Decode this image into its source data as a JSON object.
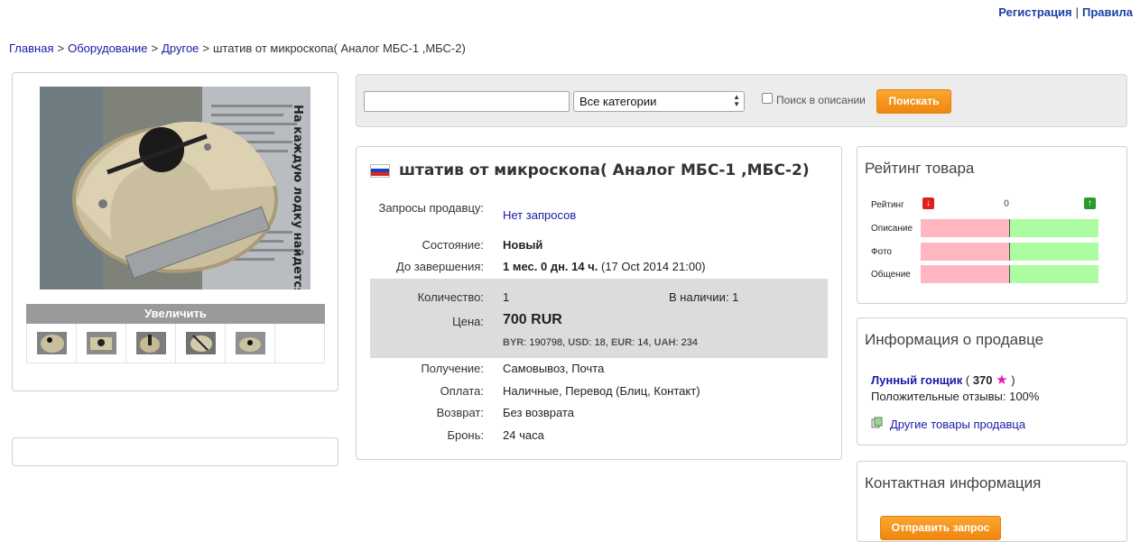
{
  "topbar": {
    "register": "Регистрация",
    "separator": "|",
    "rules": "Правила"
  },
  "breadcrumb": {
    "items": [
      "Главная",
      "Оборудование",
      "Другое"
    ],
    "current": "штатив от микроскопа( Аналог МБС-1 ,МБС-2)",
    "separator": ">"
  },
  "gallery": {
    "enlarge": "Увеличить",
    "thumb_count": 5,
    "main_photo_text": "На каждую лодку найдется своя «Булава»"
  },
  "search": {
    "query": "",
    "category": "Все категории",
    "in_description": "Поиск в описании",
    "in_description_checked": false,
    "button": "Поискать"
  },
  "product": {
    "title": "штатив от микроскопа( Аналог МБС-1 ,МБС-2)",
    "country_flag": "russia-flag",
    "requests_label": "Запросы продавцу:",
    "requests_value": "Нет запросов",
    "condition_label": "Состояние:",
    "condition_value": "Новый",
    "ends_label": "До завершения:",
    "ends_value": "1 мес. 0 дн. 14 ч.",
    "ends_date": "(17 Oct 2014 21:00)",
    "quantity_label": "Количество:",
    "quantity_value": "1",
    "in_stock_label": "В наличии:",
    "in_stock_value": "1",
    "price_label": "Цена:",
    "price_value": "700 RUR",
    "currencies": {
      "byr_label": "BYR",
      "byr_value": "190798",
      "usd_label": "USD",
      "usd_value": "18",
      "eur_label": "EUR",
      "eur_value": "14",
      "uah_label": "UAH",
      "uah_value": "234"
    },
    "delivery_label": "Получение:",
    "delivery_value": "Самовывоз, Почта",
    "payment_label": "Оплата:",
    "payment_value": "Наличные, Перевод (Блиц, Контакт)",
    "return_label": "Возврат:",
    "return_value": "Без возврата",
    "reserve_label": "Бронь:",
    "reserve_value": "24 часа"
  },
  "rating": {
    "heading": "Рейтинг товара",
    "rating_label": "Рейтинг",
    "rating_value": "0",
    "rows": [
      "Описание",
      "Фото",
      "Общение"
    ],
    "negative_share": 0.5,
    "colors": {
      "negative": "#ffb6c1",
      "positive": "#acfca2",
      "down": "#e02020",
      "up": "#2a9a2a"
    }
  },
  "seller": {
    "heading": "Информация о продавце",
    "name": "Лунный гонщик",
    "score": "370",
    "positive_label": "Положительные отзывы:",
    "positive_value": "100%",
    "other_goods": "Другие товары продавца"
  },
  "contact": {
    "heading": "Контактная информация",
    "send": "Отправить запрос"
  },
  "colors": {
    "link": "#1a1aa6",
    "accent": "#f39a1e",
    "box_gray": "#dcdcdc"
  }
}
